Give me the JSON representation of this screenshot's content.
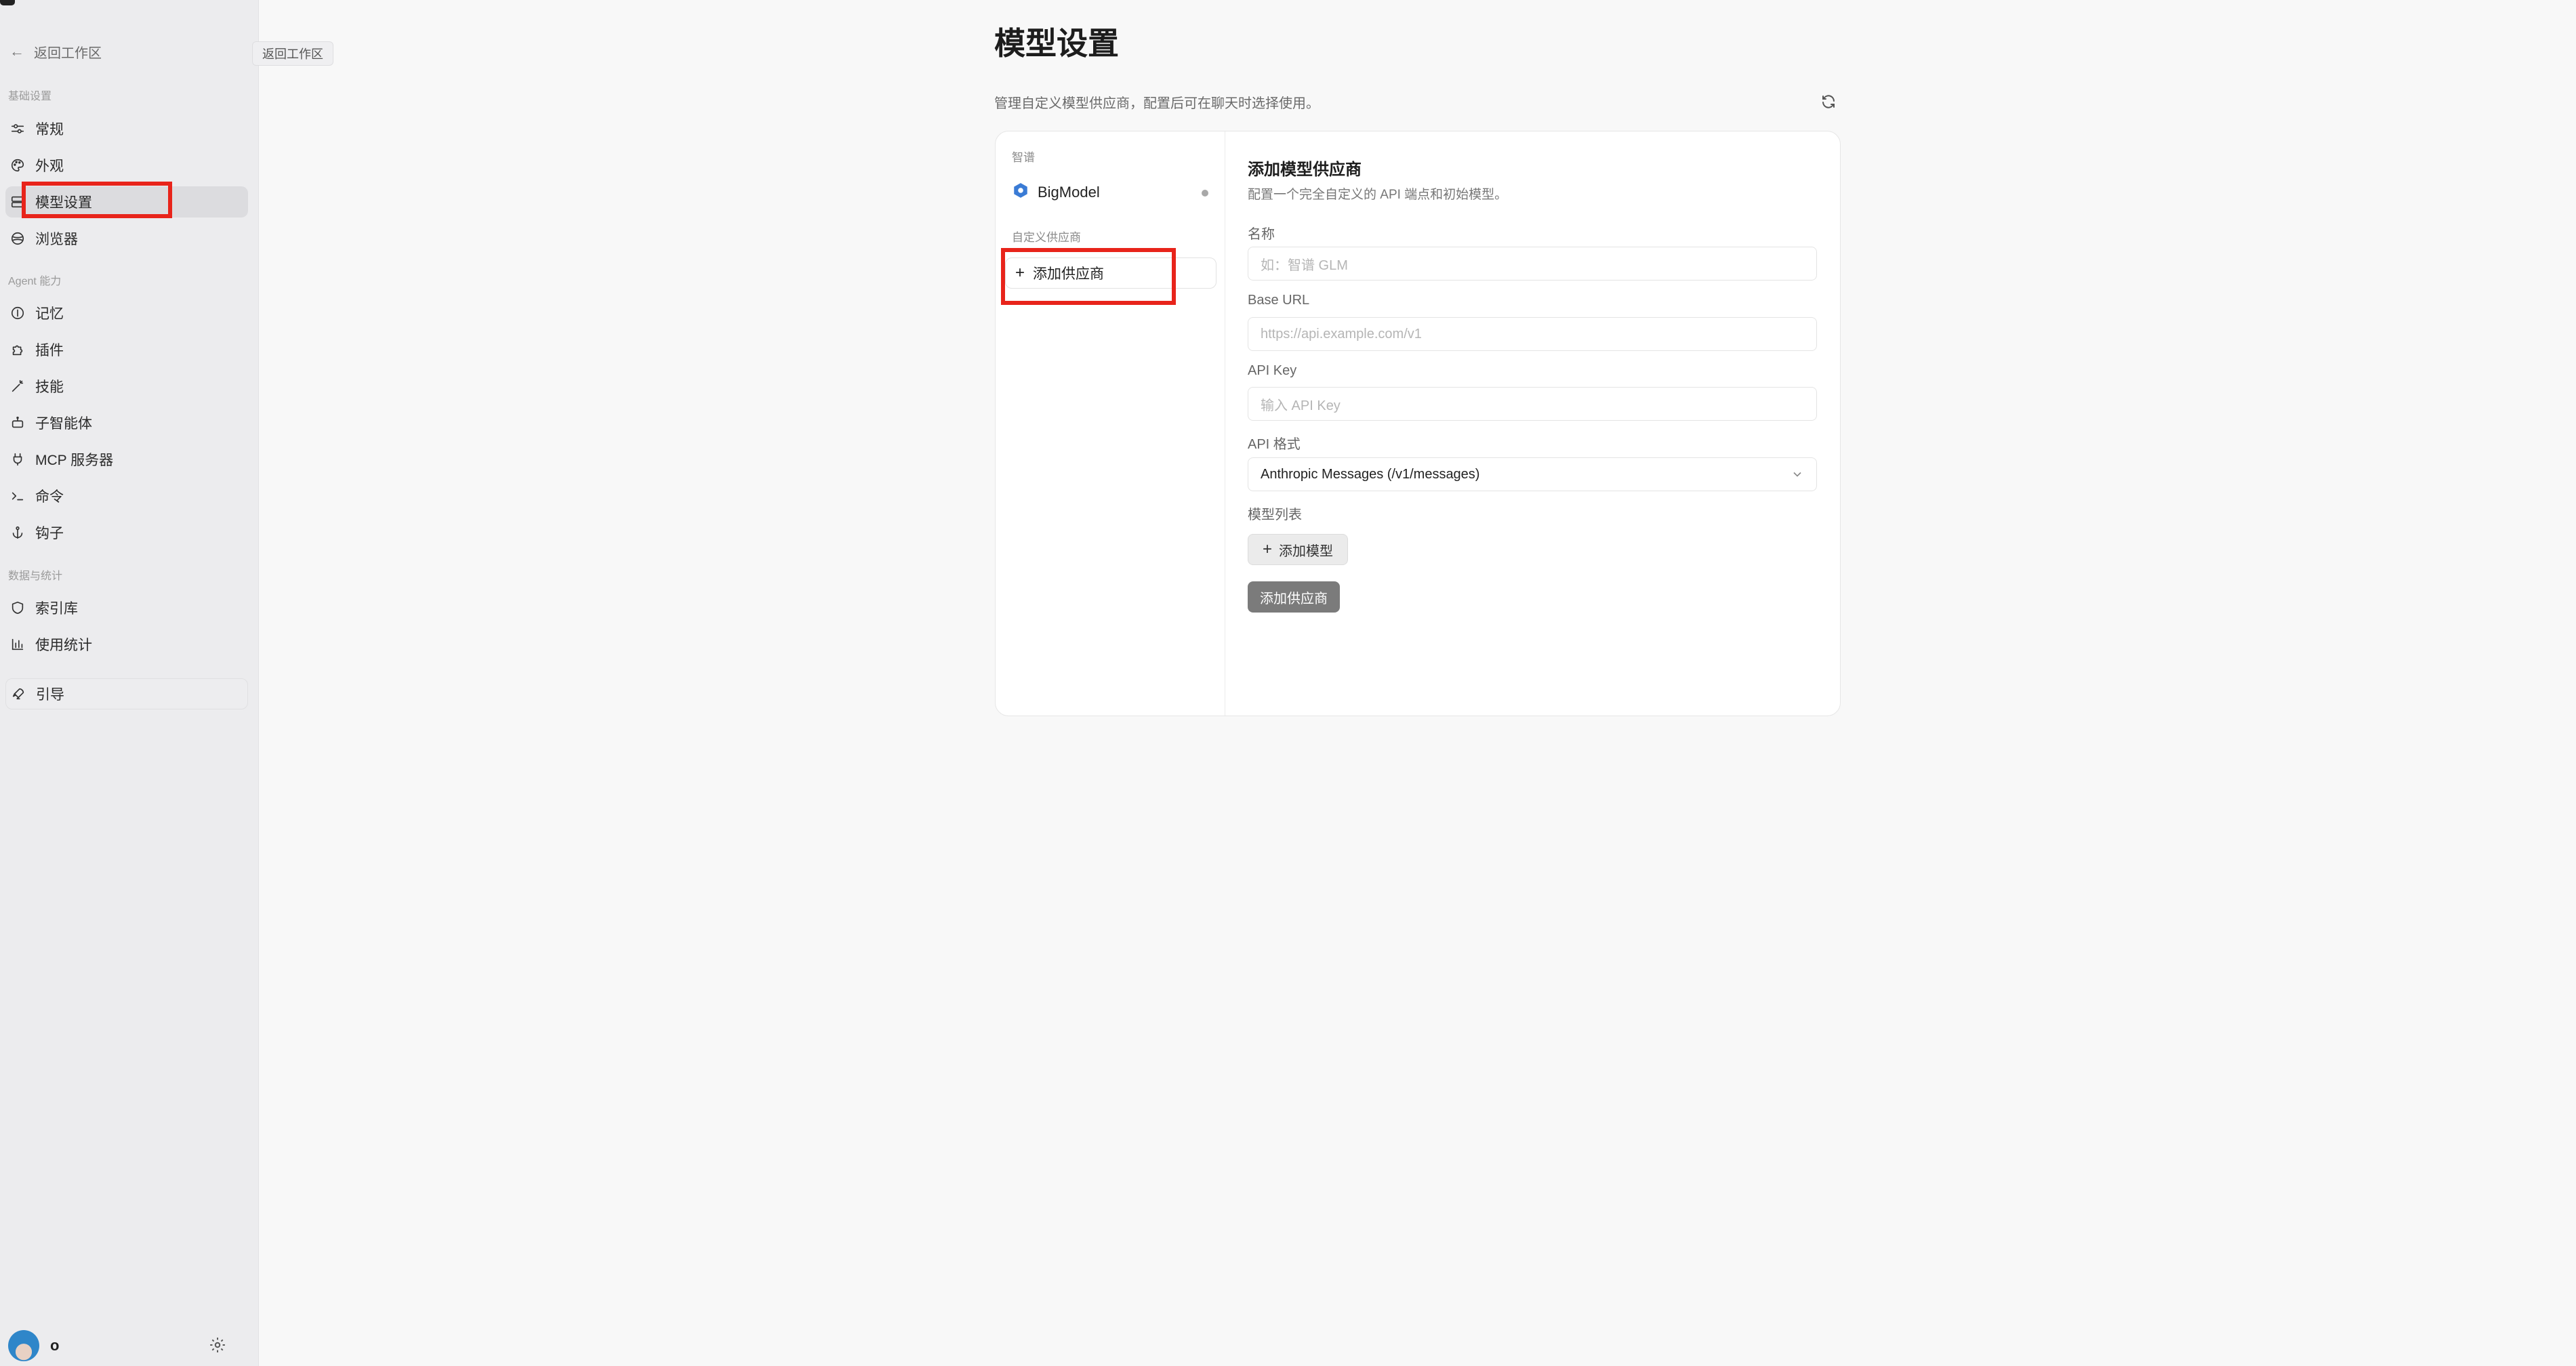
{
  "sidebar": {
    "back_label": "返回工作区",
    "tooltip": "返回工作区",
    "sections": {
      "basic": "基础设置",
      "agent": "Agent 能力",
      "data": "数据与统计"
    },
    "items": {
      "general": "常规",
      "appearance": "外观",
      "model_settings": "模型设置",
      "browser": "浏览器",
      "memory": "记忆",
      "plugins": "插件",
      "skills": "技能",
      "subagents": "子智能体",
      "mcp": "MCP 服务器",
      "commands": "命令",
      "hooks": "钩子",
      "index": "索引库",
      "usage": "使用统计",
      "guide": "引导"
    },
    "user": {
      "name": "o"
    }
  },
  "main": {
    "title": "模型设置",
    "description": "管理自定义模型供应商，配置后可在聊天时选择使用。"
  },
  "provider_list": {
    "builtin_label": "智谱",
    "builtin_provider": "BigModel",
    "custom_label": "自定义供应商",
    "add_provider": "添加供应商"
  },
  "form": {
    "title": "添加模型供应商",
    "description": "配置一个完全自定义的 API 端点和初始模型。",
    "name_label": "名称",
    "name_placeholder": "如：智谱 GLM",
    "base_url_label": "Base URL",
    "base_url_placeholder": "https://api.example.com/v1",
    "api_key_label": "API Key",
    "api_key_placeholder": "输入 API Key",
    "api_format_label": "API 格式",
    "api_format_value": "Anthropic Messages (/v1/messages)",
    "model_list_label": "模型列表",
    "add_model_button": "添加模型",
    "submit_button": "添加供应商"
  },
  "colors": {
    "highlight": "#e8241b",
    "sidebar_bg": "#ececee",
    "submit_bg": "#7b7b7b"
  }
}
